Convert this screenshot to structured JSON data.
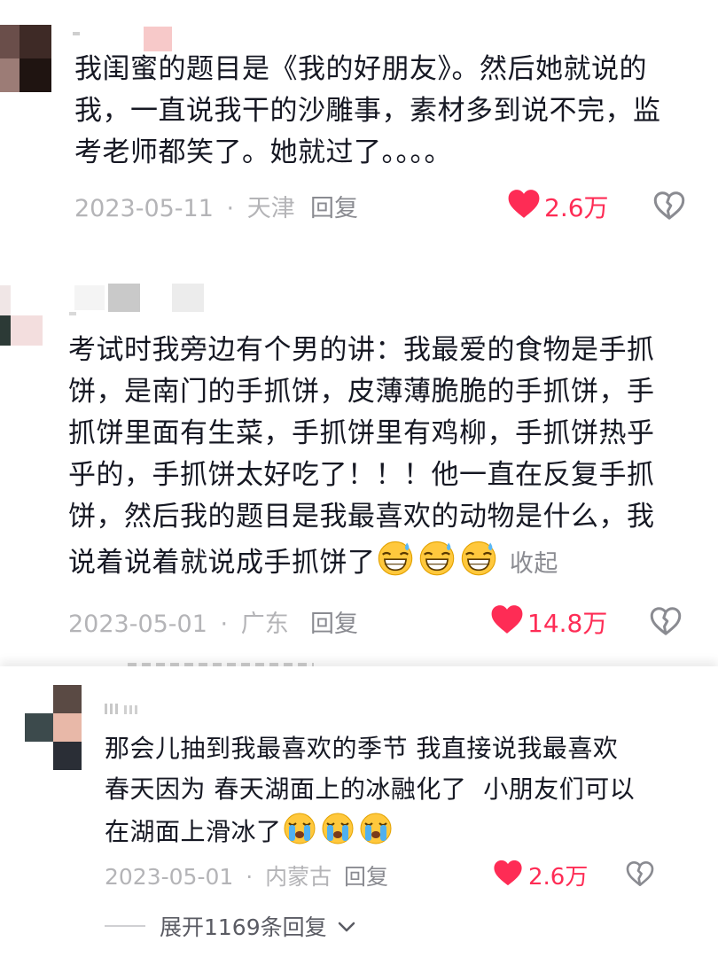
{
  "comments": [
    {
      "text_lines": [
        "我闺蜜的题目是《我的好朋友》。然后她就说的",
        "我，一直说我干的沙雕事，素材多到说不完，监",
        "考老师都笑了。她就过了。。。。"
      ],
      "date": "2023-05-11",
      "location": "天津",
      "reply_label": "回复",
      "likes": "2.6万"
    },
    {
      "text_lines": [
        "考试时我旁边有个男的讲：我最爱的食物是手抓",
        "饼，是南门的手抓饼，皮薄薄脆脆的手抓饼，手",
        "抓饼里面有生菜，手抓饼里有鸡柳，手抓饼热乎",
        "乎的，手抓饼太好吃了！！！他一直在反复手抓",
        "饼，然后我的题目是我最喜欢的动物是什么，我",
        "说着说着就说成手抓饼了"
      ],
      "collapse_label": "收起",
      "date": "2023-05-01",
      "location": "广东",
      "reply_label": "回复",
      "likes": "14.8万"
    },
    {
      "text_lines": [
        "那会儿抽到我最喜欢的季节 我直接说我最喜欢",
        "春天因为 春天湖面上的冰融化了  小朋友们可以",
        "在湖面上滑冰了"
      ],
      "date": "2023-05-01",
      "location": "内蒙古",
      "reply_label": "回复",
      "likes": "2.6万"
    }
  ],
  "expand_replies": "展开1169条回复",
  "separator": "·",
  "colors": {
    "like": "#fe2c55",
    "meta": "#b4b4b7",
    "text": "#161823"
  },
  "icons": [
    "heart-filled-icon",
    "broken-heart-icon",
    "grin-sweat-emoji",
    "loudly-crying-emoji",
    "chevron-down-icon"
  ]
}
